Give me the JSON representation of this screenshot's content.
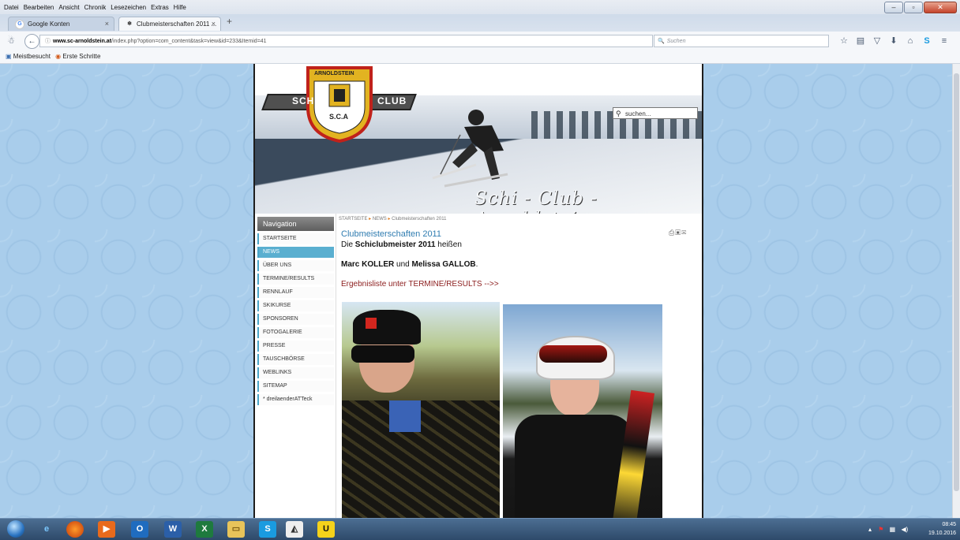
{
  "menu": [
    "Datei",
    "Bearbeiten",
    "Ansicht",
    "Chronik",
    "Lesezeichen",
    "Extras",
    "Hilfe"
  ],
  "tabs": [
    {
      "label": "Google Konten"
    },
    {
      "label": "Clubmeisterschaften 2011 ..."
    }
  ],
  "url": {
    "domain": "www.sc-arnoldstein.at",
    "path": "/index.php?option=com_content&task=view&id=233&Itemid=41"
  },
  "search_placeholder": "Suchen",
  "bookmarks": [
    "Meistbesucht",
    "Erste Schritte"
  ],
  "site": {
    "logo_top": "ARNOLDSTEIN",
    "logo_left": "SCHI",
    "logo_right": "CLUB",
    "logo_bottom": "S.C.A",
    "search_placeholder": "suchen...",
    "title": "Schi - Club - Arnoldstein"
  },
  "navigation": {
    "heading": "Navigation",
    "items": [
      "STARTSEITE",
      "NEWS",
      "ÜBER UNS",
      "TERMINE/RESULTS",
      "RENNLAUF",
      "SKIKURSE",
      "SPONSOREN",
      "FOTOGALERIE",
      "PRESSE",
      "TAUSCHBÖRSE",
      "WEBLINKS",
      "SITEMAP",
      "* dreilaenderATTeck"
    ],
    "active": "NEWS"
  },
  "breadcrumb": [
    "STARTSEITE",
    "NEWS",
    "Clubmeisterschaften 2011"
  ],
  "article": {
    "title": "Clubmeisterschaften 2011",
    "intro_pre": "Die ",
    "intro_bold": "Schiclubmeister 2011",
    "intro_post": " heißen",
    "name1": "Marc KOLLER",
    "and": " und ",
    "name2": "Melissa GALLOB",
    "period": ".",
    "link": "Ergebnisliste unter TERMINE/RESULTS -->>"
  },
  "clock": {
    "time": "08:45",
    "date": "19.10.2016"
  }
}
